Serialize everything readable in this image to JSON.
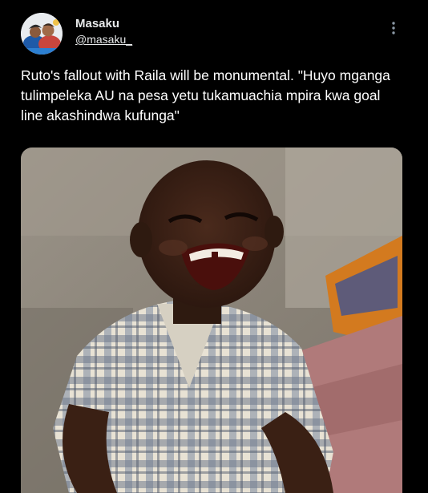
{
  "tweet": {
    "author": {
      "display_name": "Masaku",
      "handle": "@masaku_"
    },
    "text": "Ruto's fallout with Raila will be monumental. \"Huyo mganga tulimpeleka AU na pesa yetu tukamuachia mpira kwa goal line akashindwa kufunga\"",
    "menu_icon": "more-vertical-icon",
    "media": {
      "kind": "photo"
    }
  },
  "colors": {
    "background": "#000000",
    "text": "#e7e9ea"
  }
}
